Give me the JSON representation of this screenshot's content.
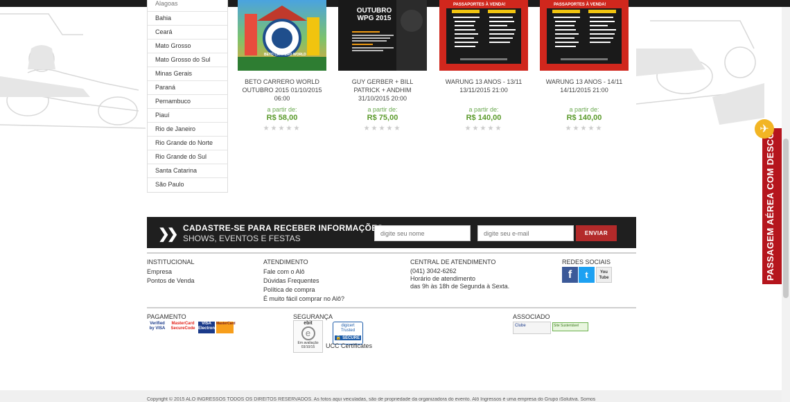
{
  "states": {
    "partial": "Alagoas",
    "items": [
      "Bahia",
      "Ceará",
      "Mato Grosso",
      "Mato Grosso do Sul",
      "Minas Gerais",
      "Paraná",
      "Pernambuco",
      "Piauí",
      "Rio de Janeiro",
      "Rio Grande do Norte",
      "Rio Grande do Sul",
      "Santa Catarina",
      "São Paulo"
    ]
  },
  "events": [
    {
      "title": "BETO CARRERO WORLD OUTUBRO 2015 01/10/2015 06:00",
      "from": "a partir de:",
      "price": "R$ 58,00",
      "poster_logo": "BETO CARRERO WORLD"
    },
    {
      "title": "GUY GERBER + BILL PATRICK + ANDHIM 31/10/2015 20:00",
      "from": "a partir de:",
      "price": "R$ 75,00",
      "poster_logo": "OUTUBRO WPG 2015"
    },
    {
      "title": "WARUNG 13 ANOS - 13/11 13/11/2015 21:00",
      "from": "a partir de:",
      "price": "R$ 140,00",
      "poster_logo": "PASSAPORTES À VENDA!"
    },
    {
      "title": "WARUNG 13 ANOS - 14/11 14/11/2015 21:00",
      "from": "a partir de:",
      "price": "R$ 140,00",
      "poster_logo": "PASSAPORTES À VENDA!"
    }
  ],
  "rating": {
    "stars": "★★★★★",
    "value": 0,
    "max": 5
  },
  "newsletter": {
    "title": "CADASTRE-SE PARA RECEBER INFORMAÇÕES:",
    "subtitle": "SHOWS, EVENTOS E FESTAS",
    "name_placeholder": "digite seu nome",
    "email_placeholder": "digite seu e-mail",
    "button": "ENVIAR"
  },
  "footer": {
    "institucional": {
      "heading": "INSTITUCIONAL",
      "links": [
        "Empresa",
        "Pontos de Venda"
      ]
    },
    "atendimento": {
      "heading": "ATENDIMENTO",
      "links": [
        "Fale com o Alô",
        "Dúvidas Frequentes",
        "Política de compra",
        "É muito fácil comprar no Alô?"
      ]
    },
    "central": {
      "heading": "CENTRAL DE ATENDIMENTO",
      "phone": "(041) 3042-6262",
      "hours_label": "Horário de atendimento",
      "hours": "das 9h às 18h de Segunda à Sexta."
    },
    "redes": {
      "heading": "REDES SOCIAIS",
      "icons": [
        "facebook-icon",
        "twitter-icon",
        "youtube-icon"
      ],
      "youtube_text": "You Tube"
    },
    "pagamento": {
      "heading": "PAGAMENTO",
      "logos": [
        "Verified by VISA",
        "MasterCard SecureCode",
        "VISA Electron",
        "MasterCard"
      ]
    },
    "seguranca": {
      "heading": "SEGURANÇA",
      "ebit": "ebit",
      "ebit_text": "Em avaliação",
      "ebit_date": "03/10/15",
      "digicert": "digicert Trusted",
      "secure": "SECURE",
      "ucc": "UCC Certificates"
    },
    "associado": {
      "heading": "ASSOCIADO",
      "logos": [
        "Clube",
        "Site Sustentável"
      ]
    }
  },
  "side_tab": {
    "label": "PASSAGEM AÉREA COM DESCONTO"
  },
  "copyright": "Copyright © 2015 ALÔ INGRESSOS TODOS OS DIREITOS RESERVADOS. As fotos aqui veiculadas, são de propriedade da organizadora do evento. Alô Ingressos é uma empresa do Grupo iSolutiva. Somos",
  "colors": {
    "accent_red": "#b32a2a",
    "price_green": "#5a9a2a",
    "dark_bar": "#1f1f1f",
    "plane_yellow": "#f2b524"
  }
}
